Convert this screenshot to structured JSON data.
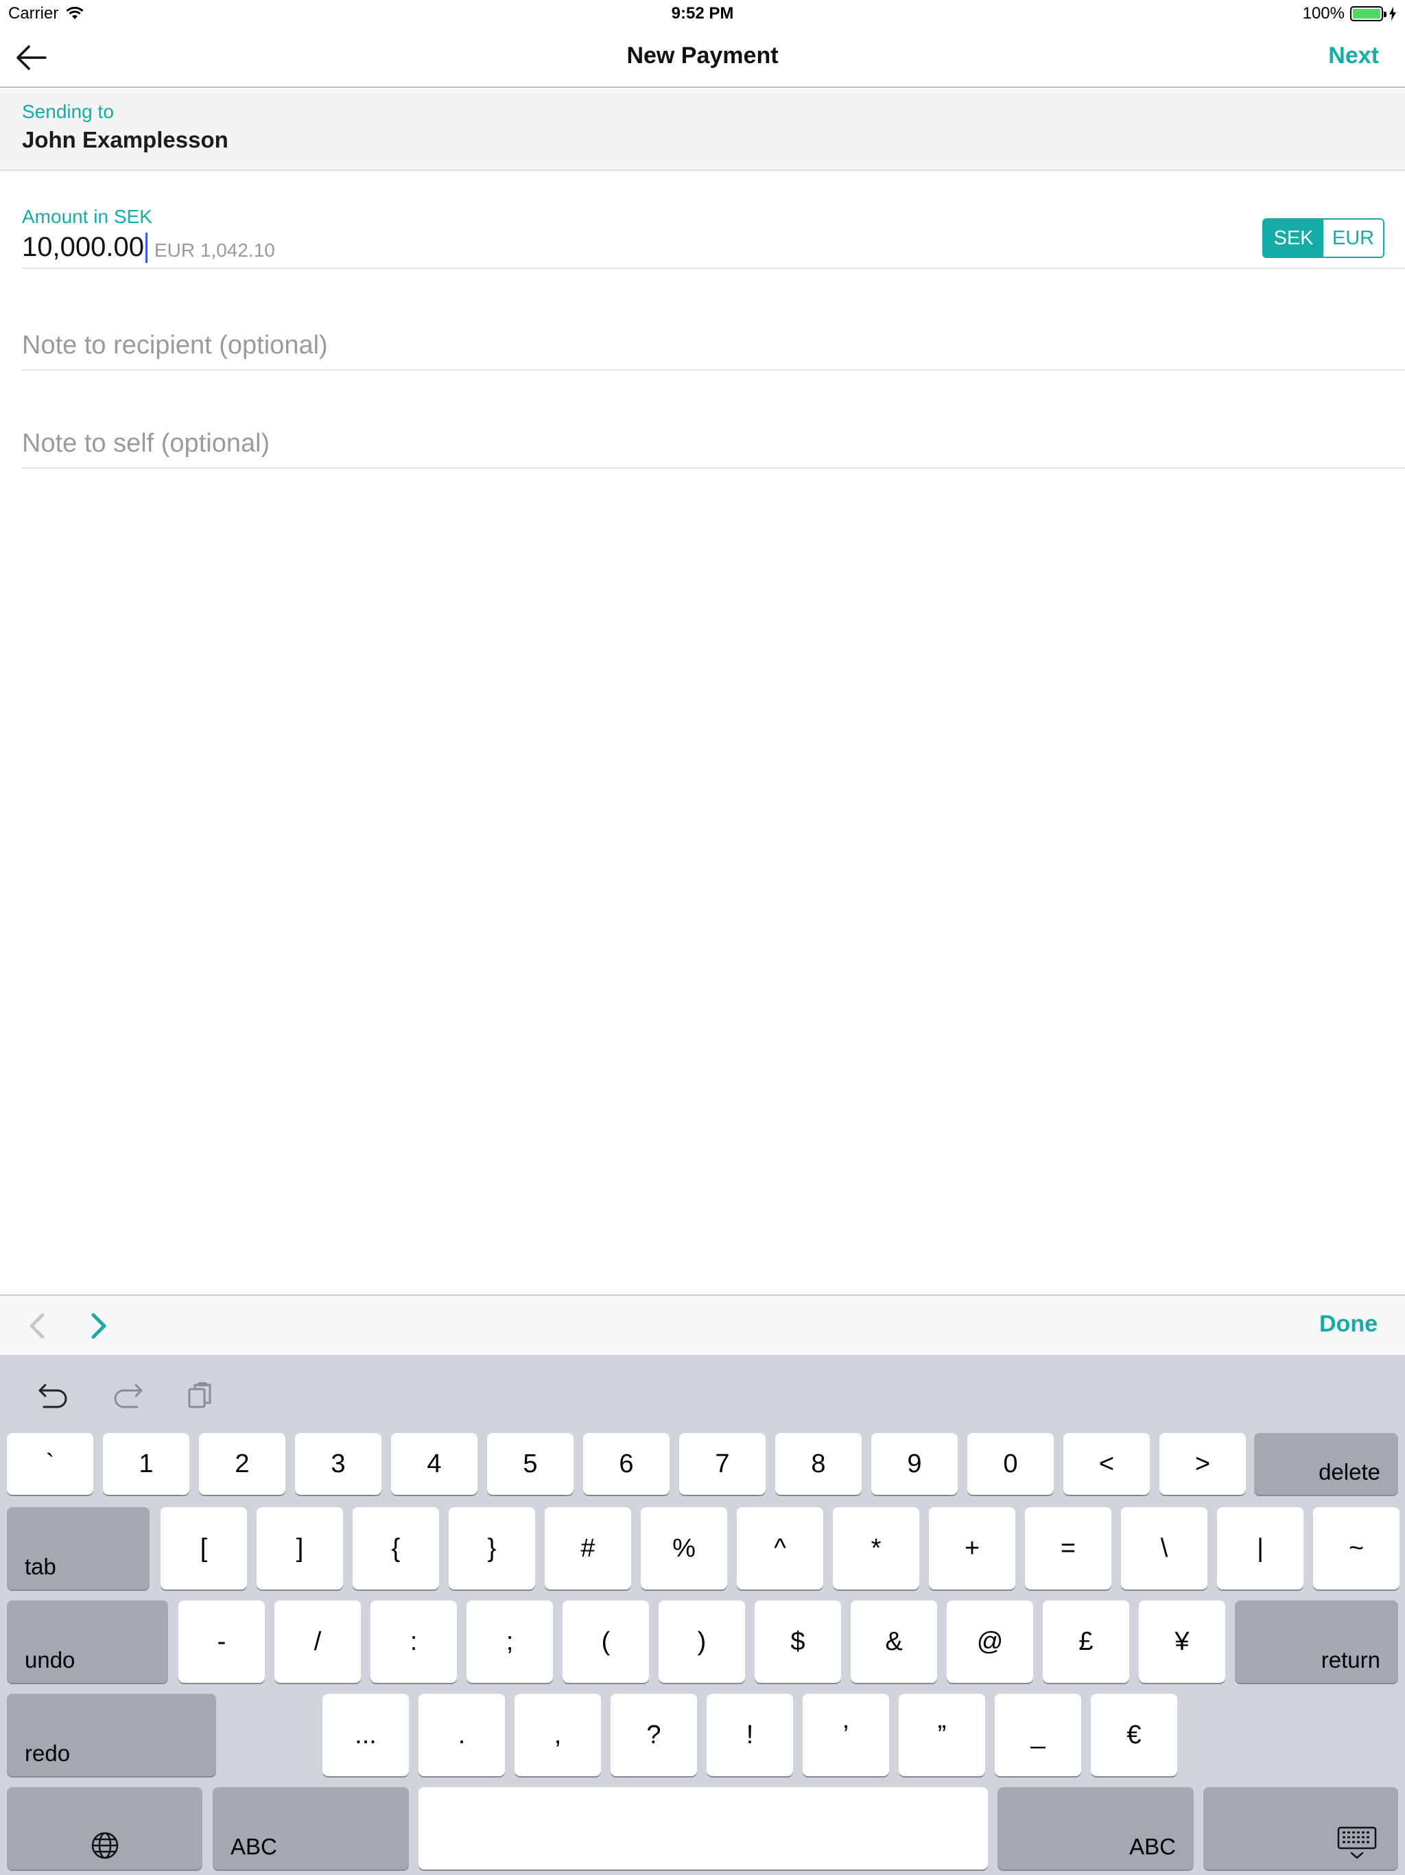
{
  "status_bar": {
    "carrier": "Carrier",
    "time": "9:52 PM",
    "battery": "100%",
    "battery_level": 1.0
  },
  "nav": {
    "title": "New Payment",
    "next_label": "Next",
    "back_icon": "arrow-left-icon"
  },
  "recipient": {
    "label": "Sending to",
    "name": "John Examplesson"
  },
  "amount": {
    "label": "Amount in SEK",
    "value": "10,000.00",
    "conversion": "EUR 1,042.10",
    "currencies": [
      "SEK",
      "EUR"
    ],
    "selected_currency": "SEK"
  },
  "notes": {
    "recipient_placeholder": "Note to recipient (optional)",
    "self_placeholder": "Note to self (optional)"
  },
  "accessory": {
    "done_label": "Done"
  },
  "keyboard": {
    "row1": [
      "`",
      "1",
      "2",
      "3",
      "4",
      "5",
      "6",
      "7",
      "8",
      "9",
      "0",
      "<",
      ">"
    ],
    "delete": "delete",
    "tab": "tab",
    "row2": [
      "[",
      "]",
      "{",
      "}",
      "#",
      "%",
      "^",
      "*",
      "+",
      "=",
      "\\",
      "|",
      "~"
    ],
    "undo": "undo",
    "row3": [
      "-",
      "/",
      ":",
      ";",
      "(",
      ")",
      "$",
      "&",
      "@",
      "£",
      "¥"
    ],
    "return": "return",
    "redo": "redo",
    "row4": [
      "...",
      ".",
      ",",
      "?",
      "!",
      "’",
      "”",
      "_",
      "€"
    ],
    "abc_left": "ABC",
    "abc_right": "ABC"
  },
  "colors": {
    "accent": "#16aba4",
    "caret": "#2f5ee8",
    "keyboard_bg": "#d1d4db",
    "fn_key": "#a3a8b3"
  }
}
